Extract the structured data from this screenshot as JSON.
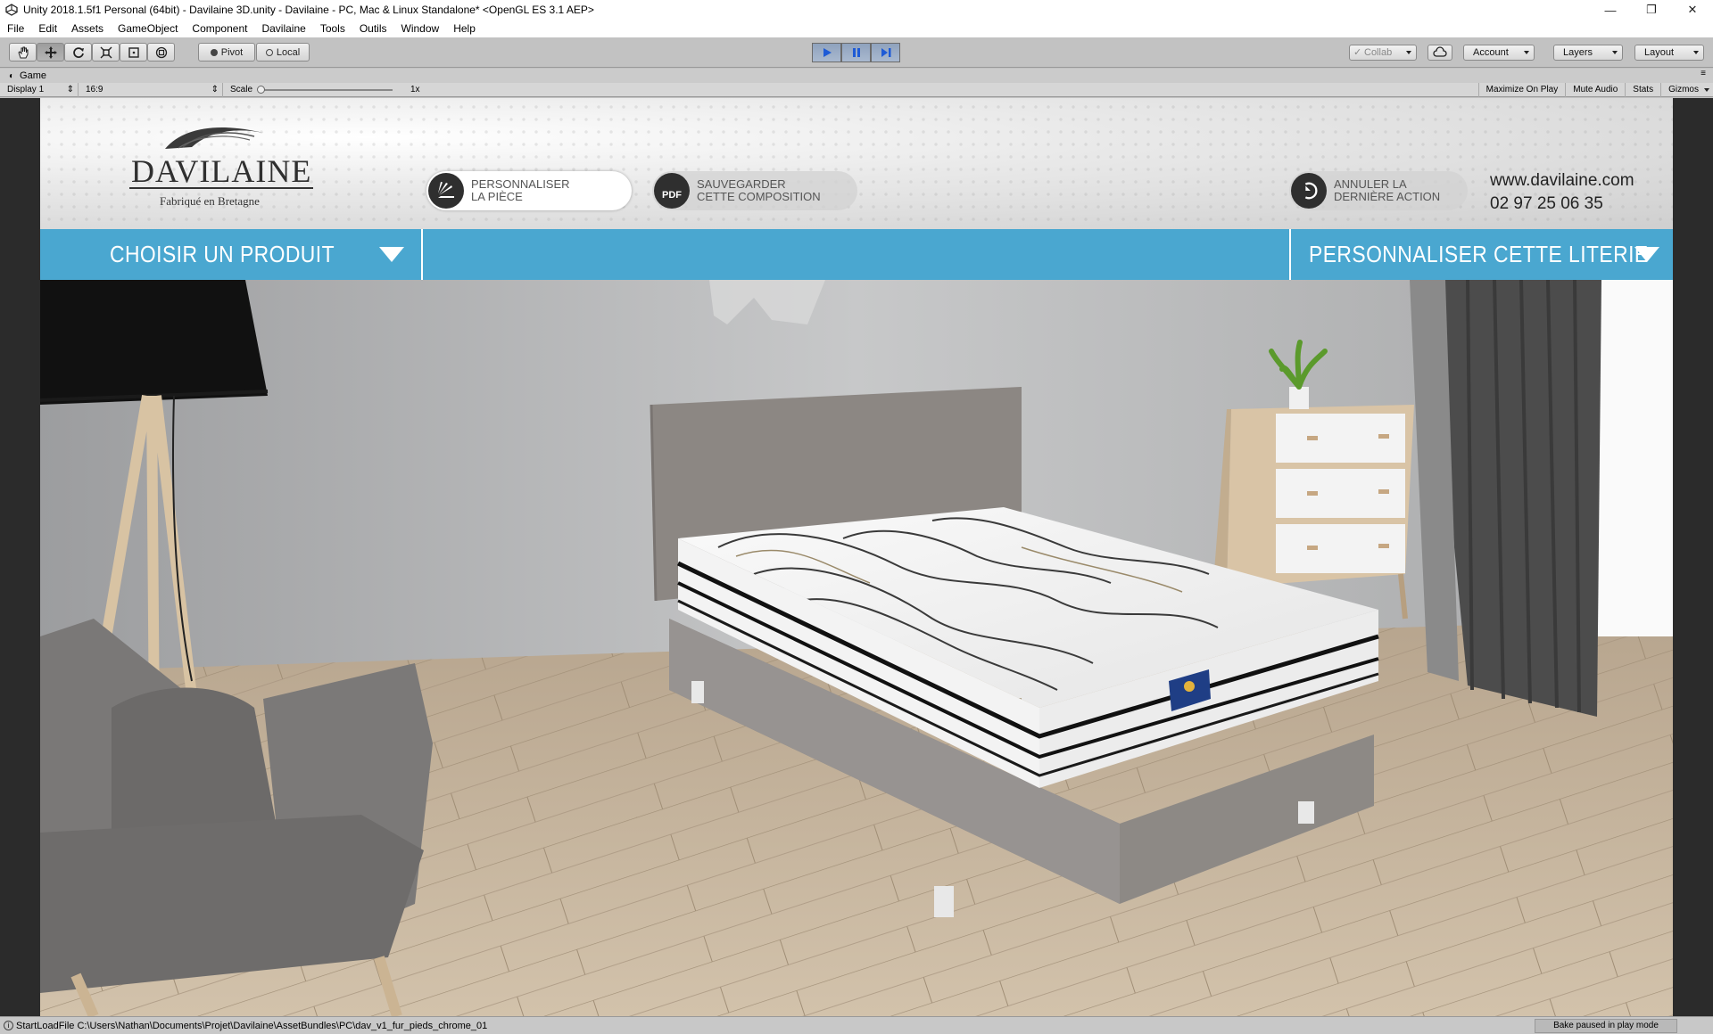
{
  "window": {
    "title": "Unity 2018.1.5f1 Personal (64bit) - Davilaine 3D.unity - Davilaine - PC, Mac & Linux Standalone* <OpenGL ES 3.1 AEP>",
    "minimize": "—",
    "maximize": "❐",
    "close": "✕"
  },
  "menu": [
    "File",
    "Edit",
    "Assets",
    "GameObject",
    "Component",
    "Davilaine",
    "Tools",
    "Outils",
    "Window",
    "Help"
  ],
  "toolbar": {
    "pivot": "Pivot",
    "local": "Local",
    "collab": "Collab",
    "account": "Account",
    "layers": "Layers",
    "layout": "Layout"
  },
  "game_view": {
    "tab": "Game",
    "display": "Display 1",
    "aspect": "16:9",
    "scale_label": "Scale",
    "scale_value": "1x",
    "maximize_on_play": "Maximize On Play",
    "mute_audio": "Mute Audio",
    "stats": "Stats",
    "gizmos": "Gizmos"
  },
  "app": {
    "brand": "DAVILAINE",
    "tagline": "Fabriqué en Bretagne",
    "btn_personalize_room": [
      "PERSONNALISER",
      "LA PIÈCE"
    ],
    "btn_save_pdf": [
      "SAUVEGARDER",
      "CETTE COMPOSITION"
    ],
    "pdf_label": "PDF",
    "btn_undo": [
      "ANNULER LA",
      "DERNIÈRE ACTION"
    ],
    "website": "www.davilaine.com",
    "phone": "02 97 25 06 35",
    "nav_choose_product": "CHOISIR UN PRODUIT",
    "nav_customize_bedding": "PERSONNALISER CETTE LITERIE"
  },
  "status": {
    "message": "StartLoadFile C:\\Users\\Nathan\\Documents\\Projet\\Davilaine\\AssetBundles\\PC\\dav_v1_fur_pieds_chrome_01",
    "bake": "Bake paused in play mode"
  },
  "colors": {
    "nav_blue": "#4aa7d0",
    "play_blue": "#1e5bd6"
  }
}
